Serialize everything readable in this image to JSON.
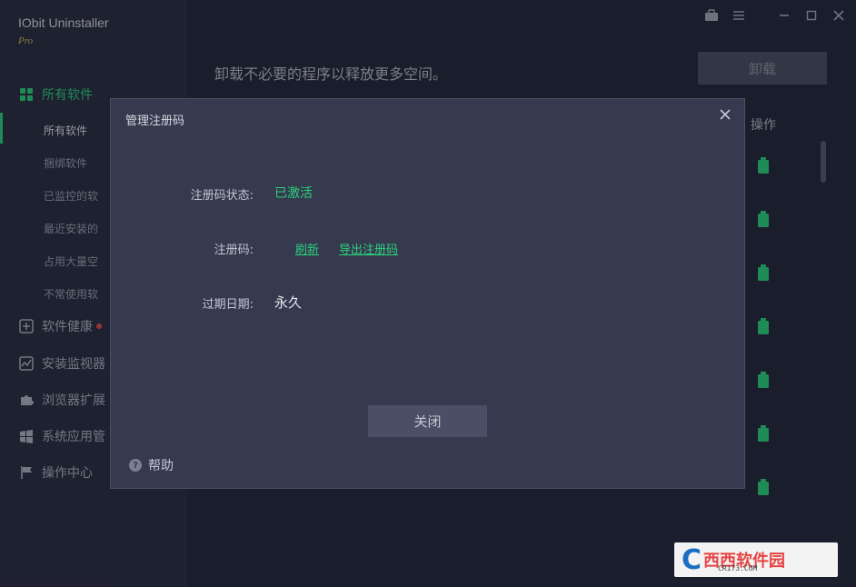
{
  "app": {
    "title": "IObit Uninstaller",
    "edition": "Pro"
  },
  "sidebar": {
    "main_item": "所有软件",
    "sub_items": [
      "所有软件",
      "捆绑软件",
      "已监控的软",
      "最近安装的",
      "占用大量空",
      "不常使用软"
    ],
    "nav_items": [
      "软件健康",
      "安装监视器",
      "浏览器扩展",
      "系统应用管",
      "操作中心"
    ]
  },
  "main": {
    "subtitle": "卸载不必要的程序以释放更多空间。",
    "uninstall_button": "卸载",
    "op_header": "操作"
  },
  "dialog": {
    "title": "管理注册码",
    "status_label": "注册码状态:",
    "status_value": "已激活",
    "code_label": "注册码:",
    "refresh_link": "刷新",
    "export_link": "导出注册码",
    "expiry_label": "过期日期:",
    "expiry_value": "永久",
    "close_button": "关闭",
    "help_label": "帮助"
  },
  "watermark": {
    "main": "西西软件园",
    "sub": "CR173.COM"
  },
  "colors": {
    "accent": "#2bd07a",
    "panel": "#363a4f",
    "sidebar": "#2a2d3f",
    "background": "#24273a"
  }
}
